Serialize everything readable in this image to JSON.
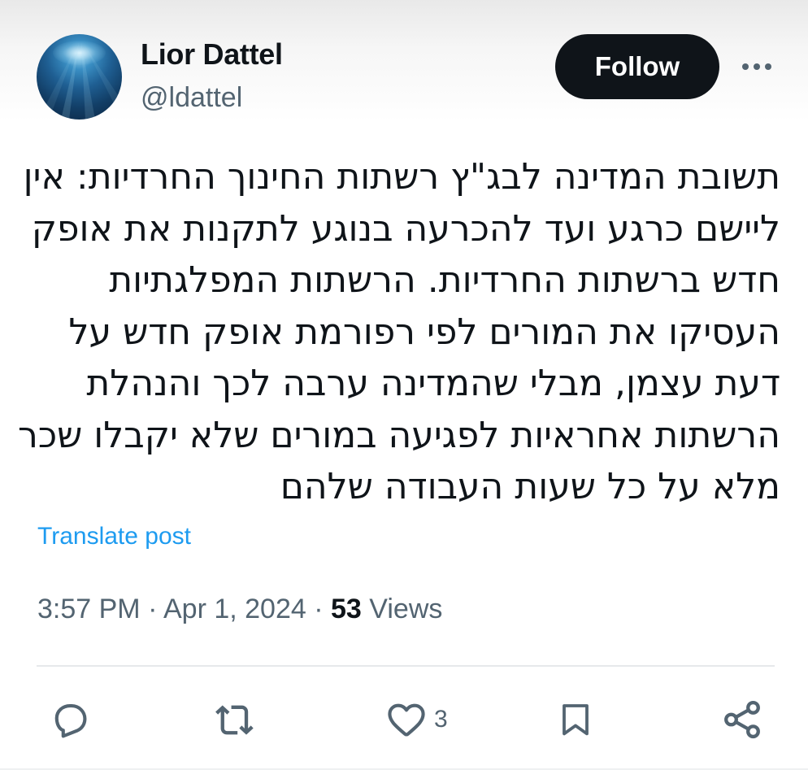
{
  "author": {
    "name": "Lior Dattel",
    "handle": "@ldattel",
    "avatar_icon": "avatar-ocean-image"
  },
  "header": {
    "follow_label": "Follow",
    "more_icon": "more-horizontal-icon"
  },
  "post": {
    "direction": "rtl",
    "lines": [
      "תשובת המדינה לבג\"ץ רשתות החינוך החרדיות: אין",
      "ליישם כרגע ועד להכרעה בנוגע לתקנות את אופק",
      "חדש ברשתות החרדיות. הרשתות המפלגתיות",
      "העסיקו את המורים לפי רפורמת אופק חדש על",
      "דעת עצמן, מבלי שהמדינה ערבה לכך והנהלת",
      "הרשתות אחראיות לפגיעה במורים שלא יקבלו שכר",
      "מלא על כל שעות העבודה שלהם"
    ],
    "translate_label": "Translate post"
  },
  "meta": {
    "time": "3:57 PM",
    "separator": "·",
    "date": "Apr 1, 2024",
    "views_count": "53",
    "views_label": "Views"
  },
  "actions": {
    "reply_icon": "reply-icon",
    "repost_icon": "repost-icon",
    "like_icon": "heart-icon",
    "like_count": "3",
    "bookmark_icon": "bookmark-icon",
    "share_icon": "share-icon"
  },
  "colors": {
    "text": "#0f1419",
    "secondary": "#536471",
    "link": "#1d9bf0",
    "button_bg": "#0f1419",
    "button_text": "#ffffff",
    "divider": "#e6e9eb"
  }
}
